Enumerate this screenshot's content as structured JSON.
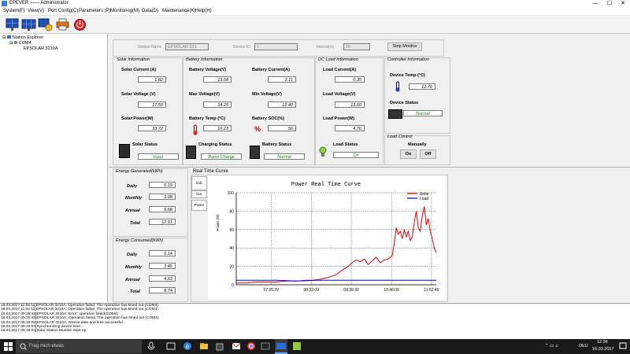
{
  "window": {
    "title": "EPEVER —— Administrator",
    "minimize": "—",
    "maximize": "☐",
    "close": "✕"
  },
  "menu": [
    "System(F)",
    "View(V)",
    "Port Config(C)",
    "Parameters (P)",
    "Monitoring(M)",
    "Data(D)",
    "Maintenance(K)",
    "Help(H)"
  ],
  "tree": {
    "root": "Station Explorer",
    "port": "COM4",
    "device": "EPSOLAR 3210A"
  },
  "header": {
    "station_name_label": "Station Name",
    "station_name_value": "EPSOLAR 321",
    "device_id_label": "Device ID",
    "device_id_value": "1",
    "interval_label": "Interval(s)",
    "interval_value": "20",
    "stop_button": "Stop Monitor"
  },
  "solar": {
    "title": "Solar Information",
    "current_label": "Solar Current (A)",
    "current": "1.82",
    "voltage_label": "Solar Voltage (V)",
    "voltage": "17.55",
    "power_label": "Solar Power(W)",
    "power": "33.72",
    "status_label": "Solar Status",
    "status": "Input"
  },
  "battery": {
    "title": "Battery Information",
    "voltage_label": "Battery Voltage(V)",
    "voltage": "13.58",
    "current_label": "Battery Current(A)",
    "current": "2.11",
    "max_label": "Max Voltage(V)",
    "max": "14.25",
    "min_label": "Min Voltage(V)",
    "min": "12.40",
    "temp_label": "Battery Temp (°C)",
    "temp": "10.23",
    "soc_label": "Battery SOC(%)",
    "soc": "56",
    "charging_label": "Charging Status",
    "charging": "Boost Charge",
    "status_label": "Battery Status",
    "status": "Normal"
  },
  "load": {
    "title": "DC Load Information",
    "current_label": "Load Current(A)",
    "current": "0.35",
    "voltage_label": "Load Voltage(V)",
    "voltage": "13.60",
    "power_label": "Load Power(W)",
    "power": "4.76",
    "status_label": "Load Status",
    "status": "On"
  },
  "controller": {
    "title": "Controller Information",
    "temp_label": "Device Temp (°C)",
    "temp": "12.76",
    "status_label": "Device Status",
    "status": "Normal"
  },
  "load_control": {
    "title": "Load Control",
    "manually": "Manually",
    "on": "On",
    "off": "Off"
  },
  "energy_generated": {
    "title": "Energy Generated(kWh)",
    "daily_label": "Daily",
    "daily": "0.19",
    "monthly_label": "Monthly",
    "monthly": "3.08",
    "annual_label": "Annual",
    "annual": "6.68",
    "total_label": "Total",
    "total": "12.91"
  },
  "energy_consumed": {
    "title": "Energy Consumed(kWh)",
    "daily_label": "Daily",
    "daily": "0.14",
    "monthly_label": "Monthly",
    "monthly": "2.45",
    "annual_label": "Annual",
    "annual": "4.63",
    "total_label": "Total",
    "total": "8.74"
  },
  "curve": {
    "section_title": "Real Time Curve",
    "tabs": [
      "Volt.",
      "Cur.",
      "Power"
    ]
  },
  "chart_data": {
    "type": "line",
    "title": "Power Real Time Curve",
    "ylabel": "Power (W)",
    "xlabel": "",
    "ylim": [
      0,
      100
    ],
    "yticks": [
      "0",
      "20",
      "40",
      "60",
      "80",
      "100"
    ],
    "x_tick_labels": [
      "07:25:29",
      "08:32:09",
      "09:39:30",
      "10:46:09",
      "11:52:49"
    ],
    "x_range": [
      0,
      100
    ],
    "x_ticks": [
      17.4,
      37.5,
      57.5,
      77.6,
      97.6
    ],
    "grid": true,
    "legend_position": "top-right",
    "series": [
      {
        "name": "Solar",
        "color": "#e00000",
        "x": [
          0,
          5,
          10,
          15,
          20,
          25,
          30,
          35,
          38,
          42,
          46,
          50,
          53,
          56,
          58,
          60,
          62,
          64,
          66,
          68,
          70,
          72,
          74,
          76,
          78,
          79,
          80,
          81,
          82,
          83,
          84,
          85,
          86,
          87,
          88,
          89,
          90,
          91,
          92,
          93,
          94,
          95,
          96,
          97,
          98,
          99,
          100
        ],
        "y": [
          2,
          2,
          3,
          3,
          3,
          4,
          4,
          5,
          5,
          6,
          8,
          11,
          16,
          20,
          24,
          27,
          25,
          28,
          22,
          26,
          30,
          24,
          27,
          28,
          32,
          45,
          62,
          55,
          58,
          50,
          60,
          52,
          58,
          48,
          52,
          68,
          80,
          62,
          58,
          75,
          85,
          65,
          72,
          58,
          50,
          40,
          35
        ]
      },
      {
        "name": "Load",
        "color": "#0000dd",
        "x": [
          0,
          10,
          20,
          30,
          40,
          50,
          60,
          70,
          80,
          90,
          100
        ],
        "y": [
          5,
          5,
          5,
          4,
          5,
          5,
          5,
          5,
          5,
          5,
          5
        ]
      }
    ]
  },
  "log": [
    "16.03.2017 11:55:11[EPSOLAR 3210A: Operation failed. The operation has timed out (COM4)",
    "16.03.2017 11:02:11[EPSOLAR 3210A: Operation failed. The operation has timed out (COM4)",
    "16.03.2017 09:25:45[EPSOLAR 3210A: Error: operation failed(COM4)",
    "16.03.2017 09:20:45[EPSOLAR 3210A: Operation failed. The operation has timed out (COM4)",
    "16.03.2017 06:19:06[EPSOLAR 3210A: Device date and time successful",
    "16.03.2017 06:19:04[Synchronizing device time...",
    "16.03.2017 06:19:04[Solar Station Monitor Start up"
  ],
  "taskbar": {
    "search_placeholder": "Frag mich etwas",
    "language": "DEU",
    "time": "12:36",
    "date": "16.03.2017"
  }
}
